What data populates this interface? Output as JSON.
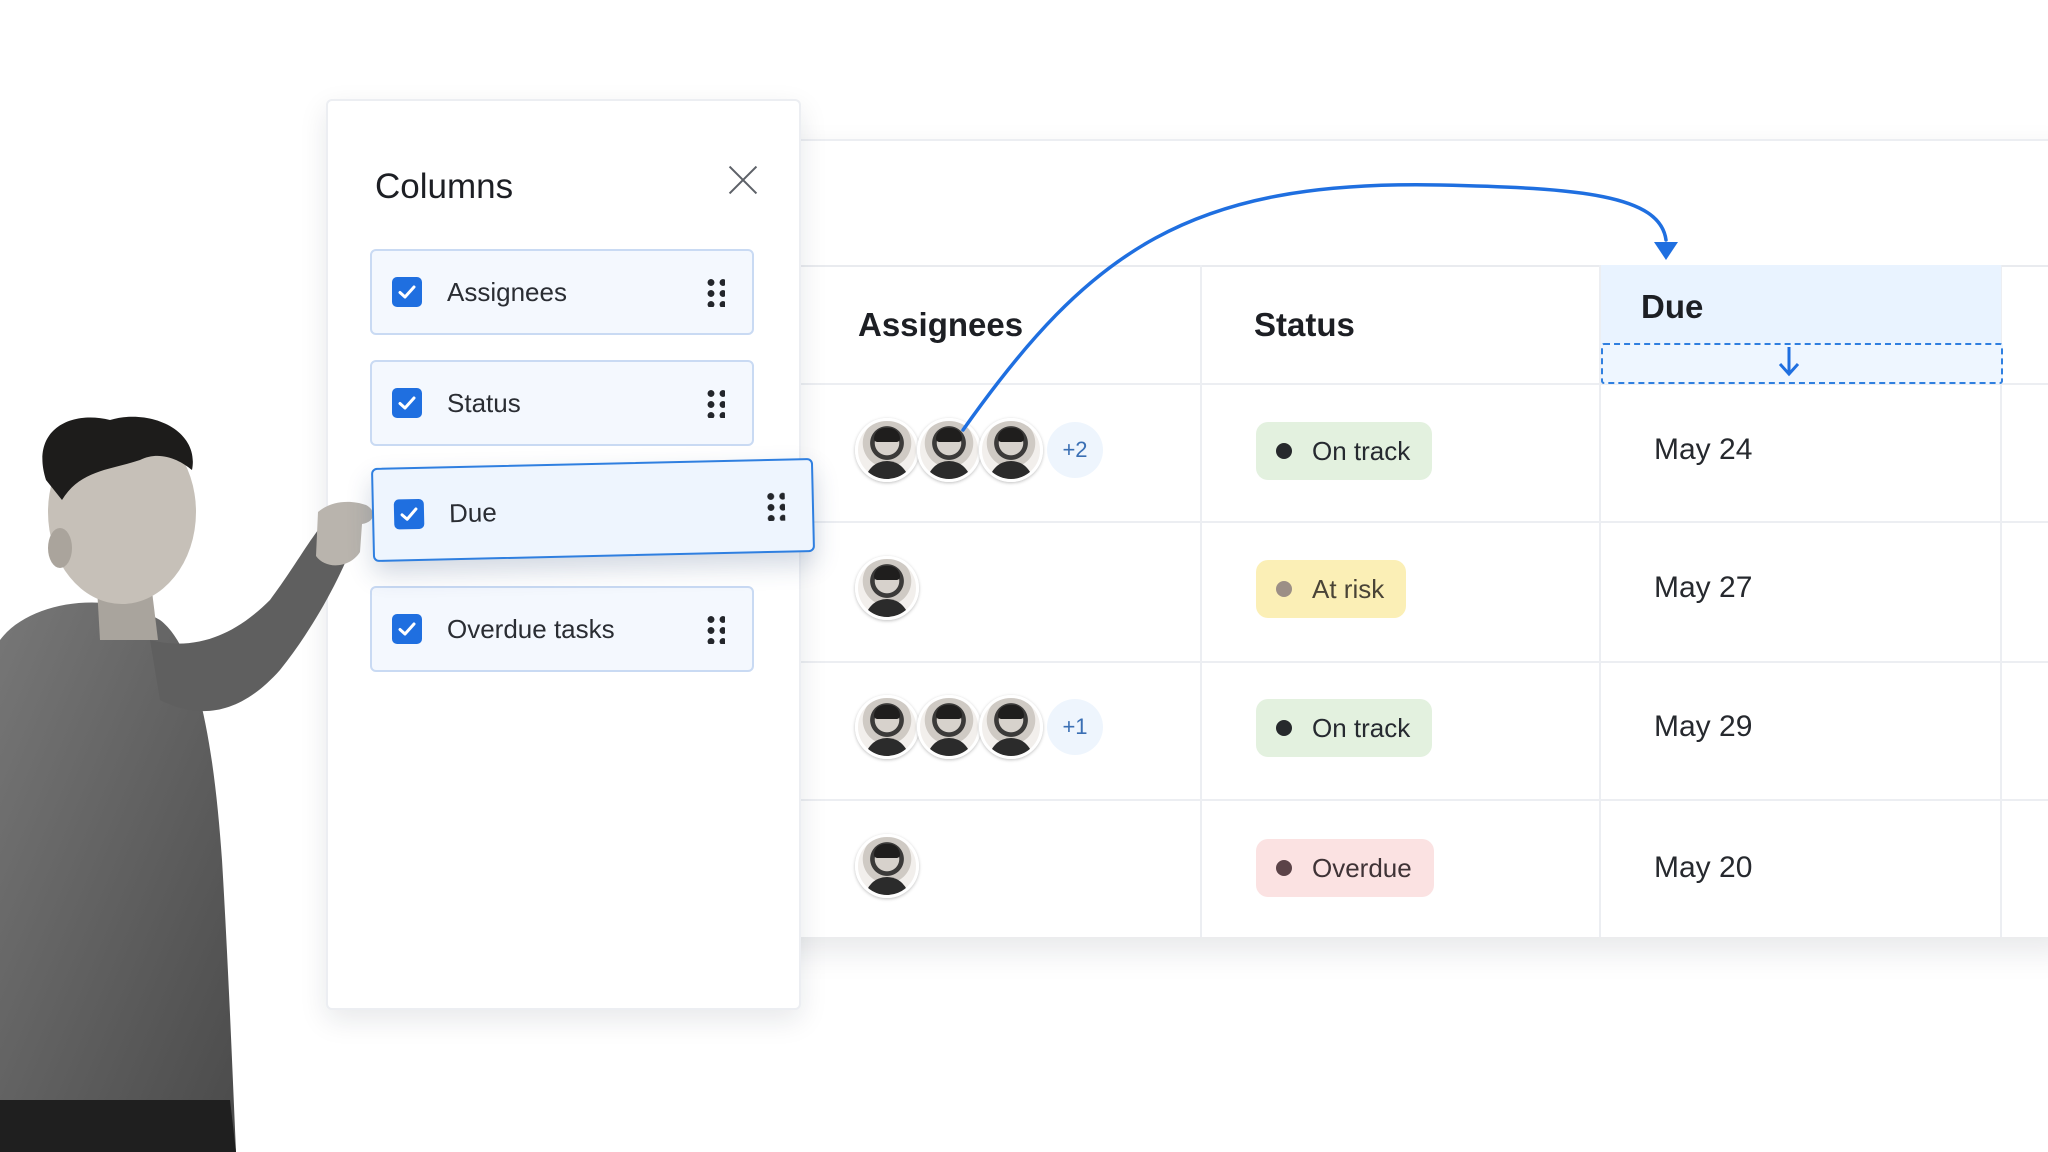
{
  "panel": {
    "title": "Columns",
    "items": [
      {
        "label": "Assignees",
        "checked": true
      },
      {
        "label": "Status",
        "checked": true
      },
      {
        "label": "Due",
        "checked": true,
        "dragging": true
      },
      {
        "label": "Overdue tasks",
        "checked": true
      }
    ]
  },
  "table": {
    "headers": [
      "Assignees",
      "Status",
      "Due"
    ],
    "rows": [
      {
        "assignee_count": 3,
        "extra_assignees": "+2",
        "status": "On track",
        "status_kind": "on-track",
        "due": "May 24"
      },
      {
        "assignee_count": 1,
        "extra_assignees": "",
        "status": "At risk",
        "status_kind": "at-risk",
        "due": "May 27"
      },
      {
        "assignee_count": 3,
        "extra_assignees": "+1",
        "status": "On track",
        "status_kind": "on-track",
        "due": "May 29"
      },
      {
        "assignee_count": 1,
        "extra_assignees": "",
        "status": "Overdue",
        "status_kind": "overdue",
        "due": "May 20"
      }
    ]
  },
  "colors": {
    "accent": "#1f6fe0",
    "on_track": "#e3f1df",
    "at_risk": "#fbefb6",
    "overdue": "#fbe2e2"
  },
  "icons": {
    "close": "close-icon",
    "checkbox": "checkmark-icon",
    "drag": "drag-handle-icon",
    "drop_target": "arrow-down-icon"
  }
}
